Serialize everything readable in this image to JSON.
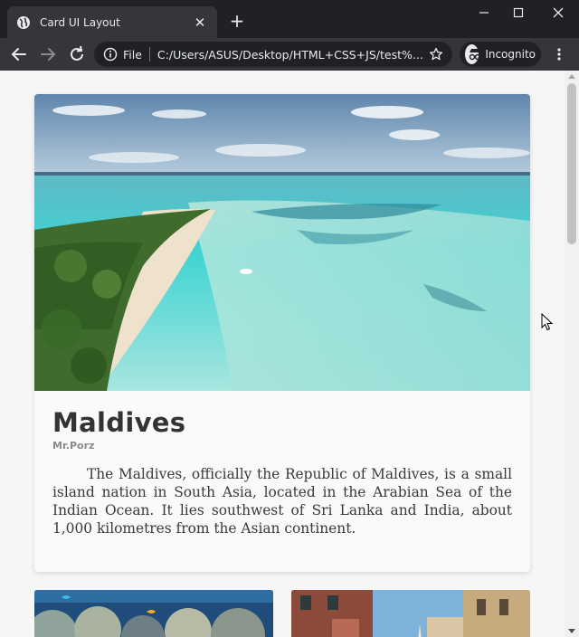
{
  "browser": {
    "tab_title": "Card UI Layout",
    "tab_close": "✕",
    "new_tab": "+",
    "omnibox": {
      "scheme": "File",
      "url": "C:/Users/ASUS/Desktop/HTML+CSS+JS/test%..."
    },
    "incognito_label": "Incognito",
    "icons": [
      "globe-icon",
      "back-arrow-icon",
      "forward-arrow-icon",
      "info-icon",
      "star-icon",
      "incognito-icon",
      "kebab-menu-icon",
      "minimize-icon",
      "maximize-icon",
      "close-window-icon"
    ]
  },
  "page": {
    "background": "#f6f6f6",
    "main_card": {
      "title": "Maldives",
      "author": "Mr.Porz",
      "text": "The Maldives, officially the Republic of Maldives, is a small island nation in South Asia, located in the Arabian Sea of the Indian Ocean. It lies southwest of Sri Lanka and India, about 1,000 kilometres from the Asian continent."
    },
    "colors": {
      "title": "#333333",
      "author": "#8a8a8a",
      "text": "#3a3a3a",
      "sea": "#3fd3d3",
      "chrome_dark": "#202124",
      "chrome_toolbar": "#35363a"
    }
  }
}
